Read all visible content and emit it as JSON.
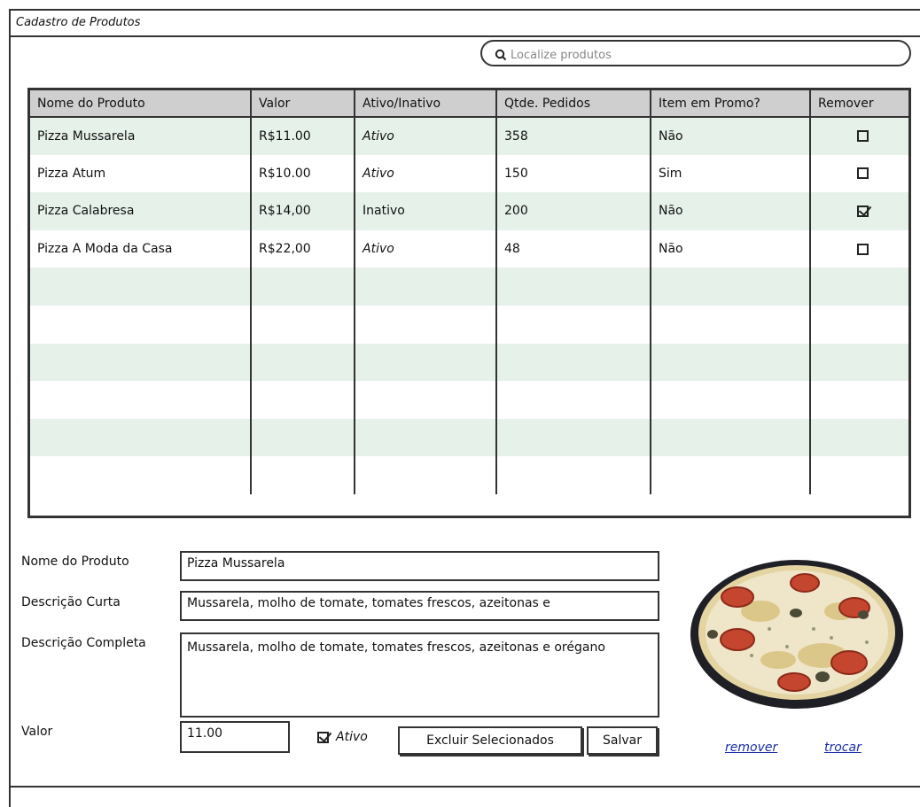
{
  "window": {
    "title": "Cadastro de Produtos"
  },
  "search": {
    "placeholder": "Localize produtos"
  },
  "table": {
    "headers": [
      "Nome do Produto",
      "Valor",
      "Ativo/Inativo",
      "Qtde. Pedidos",
      "Item em Promo?",
      "Remover"
    ],
    "rows": [
      {
        "name": "Pizza Mussarela",
        "valor": "R$11.00",
        "status": "Ativo",
        "pedidos": "358",
        "promo": "Não",
        "remover": false
      },
      {
        "name": "Pizza Atum",
        "valor": "R$10.00",
        "status": "Ativo",
        "pedidos": "150",
        "promo": "Sim",
        "remover": false
      },
      {
        "name": "Pizza Calabresa",
        "valor": "R$14,00",
        "status": "Inativo",
        "pedidos": "200",
        "promo": "Não",
        "remover": true
      },
      {
        "name": "Pizza A Moda da Casa",
        "valor": "R$22,00",
        "status": "Ativo",
        "pedidos": "48",
        "promo": "Não",
        "remover": false
      }
    ]
  },
  "form": {
    "nome_label": "Nome do Produto",
    "nome_value": "Pizza Mussarela",
    "desc_curta_label": "Descrição Curta",
    "desc_curta_value": "Mussarela, molho de tomate, tomates frescos, azeitonas e",
    "desc_completa_label": "Descrição Completa",
    "desc_completa_value": "Mussarela, molho de tomate, tomates frescos, azeitonas e orégano",
    "valor_label": "Valor",
    "valor_value": "11.00",
    "ativo_label": "Ativo",
    "ativo_checked": true,
    "excluir_label": "Excluir Selecionados",
    "salvar_label": "Salvar"
  },
  "image": {
    "remover_label": "remover",
    "trocar_label": "trocar"
  },
  "colors": {
    "header_bg": "#cfcfcf",
    "row_alt_bg": "#e6f1ea",
    "link": "#1a2fa8"
  }
}
